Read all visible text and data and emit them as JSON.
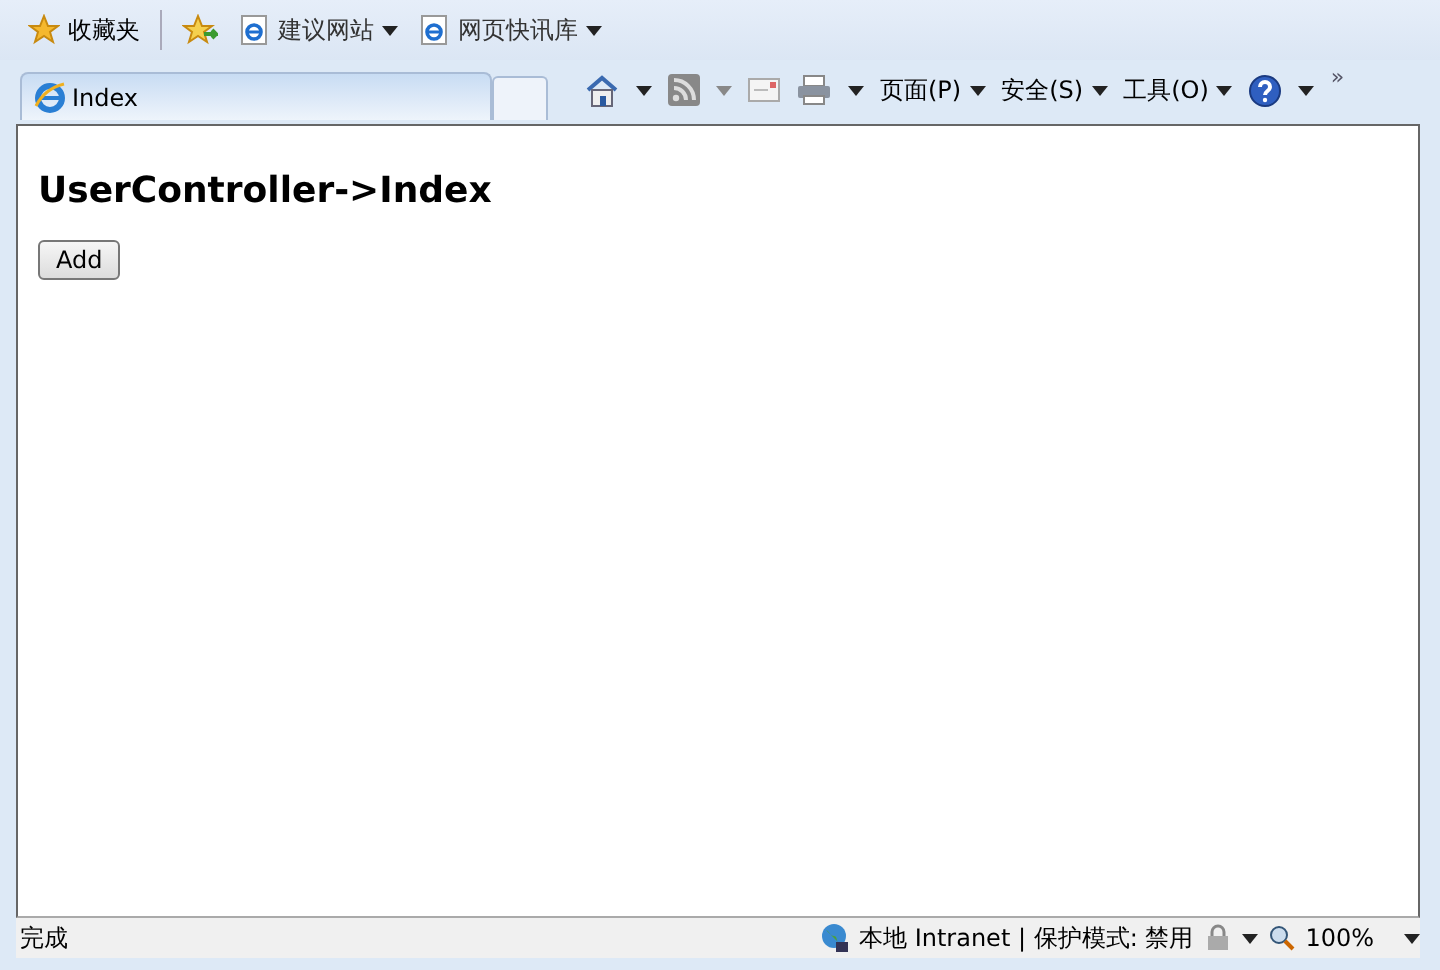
{
  "favorites_bar": {
    "favorites": "收藏夹",
    "links": [
      {
        "label": "建议网站"
      },
      {
        "label": "网页快讯库"
      }
    ]
  },
  "tab": {
    "title": "Index",
    "selected": true
  },
  "command_bar": {
    "menus": [
      {
        "label": "页面(P)"
      },
      {
        "label": "安全(S)"
      },
      {
        "label": "工具(O)"
      }
    ],
    "overflow": "»"
  },
  "page": {
    "heading": "UserController->Index",
    "button": "Add"
  },
  "status_bar": {
    "status": "完成",
    "zone": "本地 Intranet | 保护模式: 禁用",
    "zoom": "100%"
  }
}
